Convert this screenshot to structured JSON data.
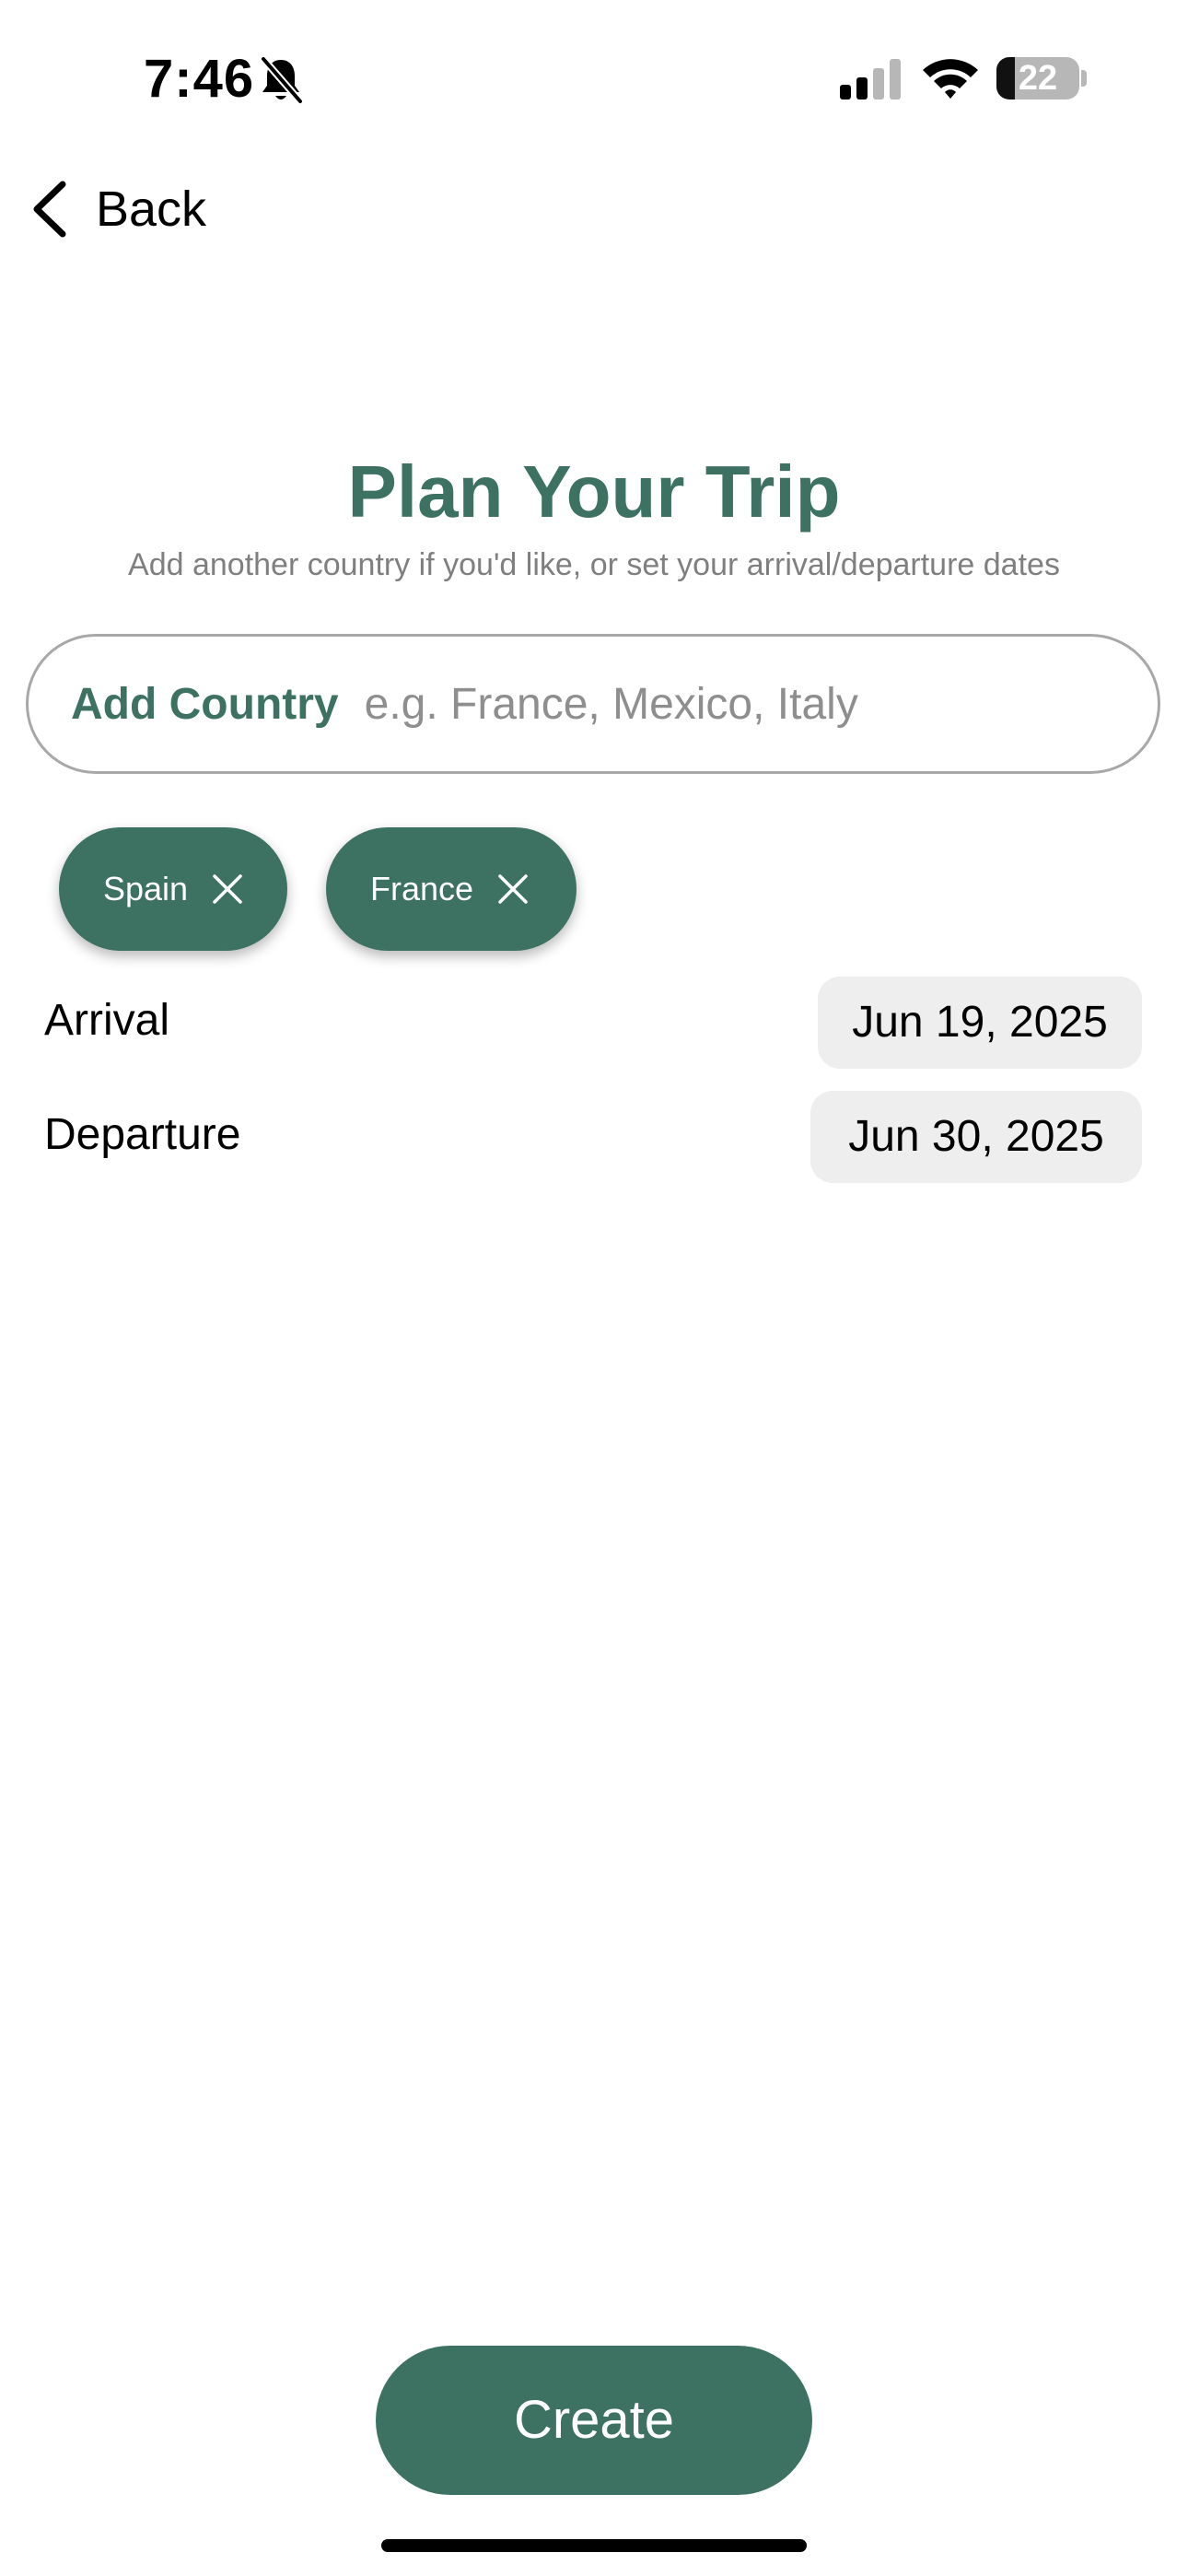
{
  "status_bar": {
    "time": "7:46",
    "battery_level": "22",
    "battery_fraction": 0.22,
    "icons": [
      "bell-slash-icon",
      "signal-icon",
      "wifi-icon",
      "battery-icon"
    ]
  },
  "nav": {
    "back_label": "Back",
    "back_icon": "chevron-left-icon"
  },
  "header": {
    "title": "Plan Your Trip",
    "subtitle": "Add another country if you'd like, or set your arrival/departure dates"
  },
  "country_field": {
    "label": "Add Country",
    "value": "",
    "placeholder": "e.g. France, Mexico, Italy"
  },
  "selected_countries": [
    {
      "label": "Spain",
      "remove_icon": "close-icon"
    },
    {
      "label": "France",
      "remove_icon": "close-icon"
    }
  ],
  "dates": {
    "arrival_label": "Arrival",
    "arrival_value": "Jun 19, 2025",
    "departure_label": "Departure",
    "departure_value": "Jun 30, 2025"
  },
  "actions": {
    "create_label": "Create"
  },
  "colors": {
    "accent": "#3d7263",
    "subtitle": "#7f7f7f",
    "field_border": "#a8a8a8",
    "date_pill_bg": "#eeeeee"
  }
}
